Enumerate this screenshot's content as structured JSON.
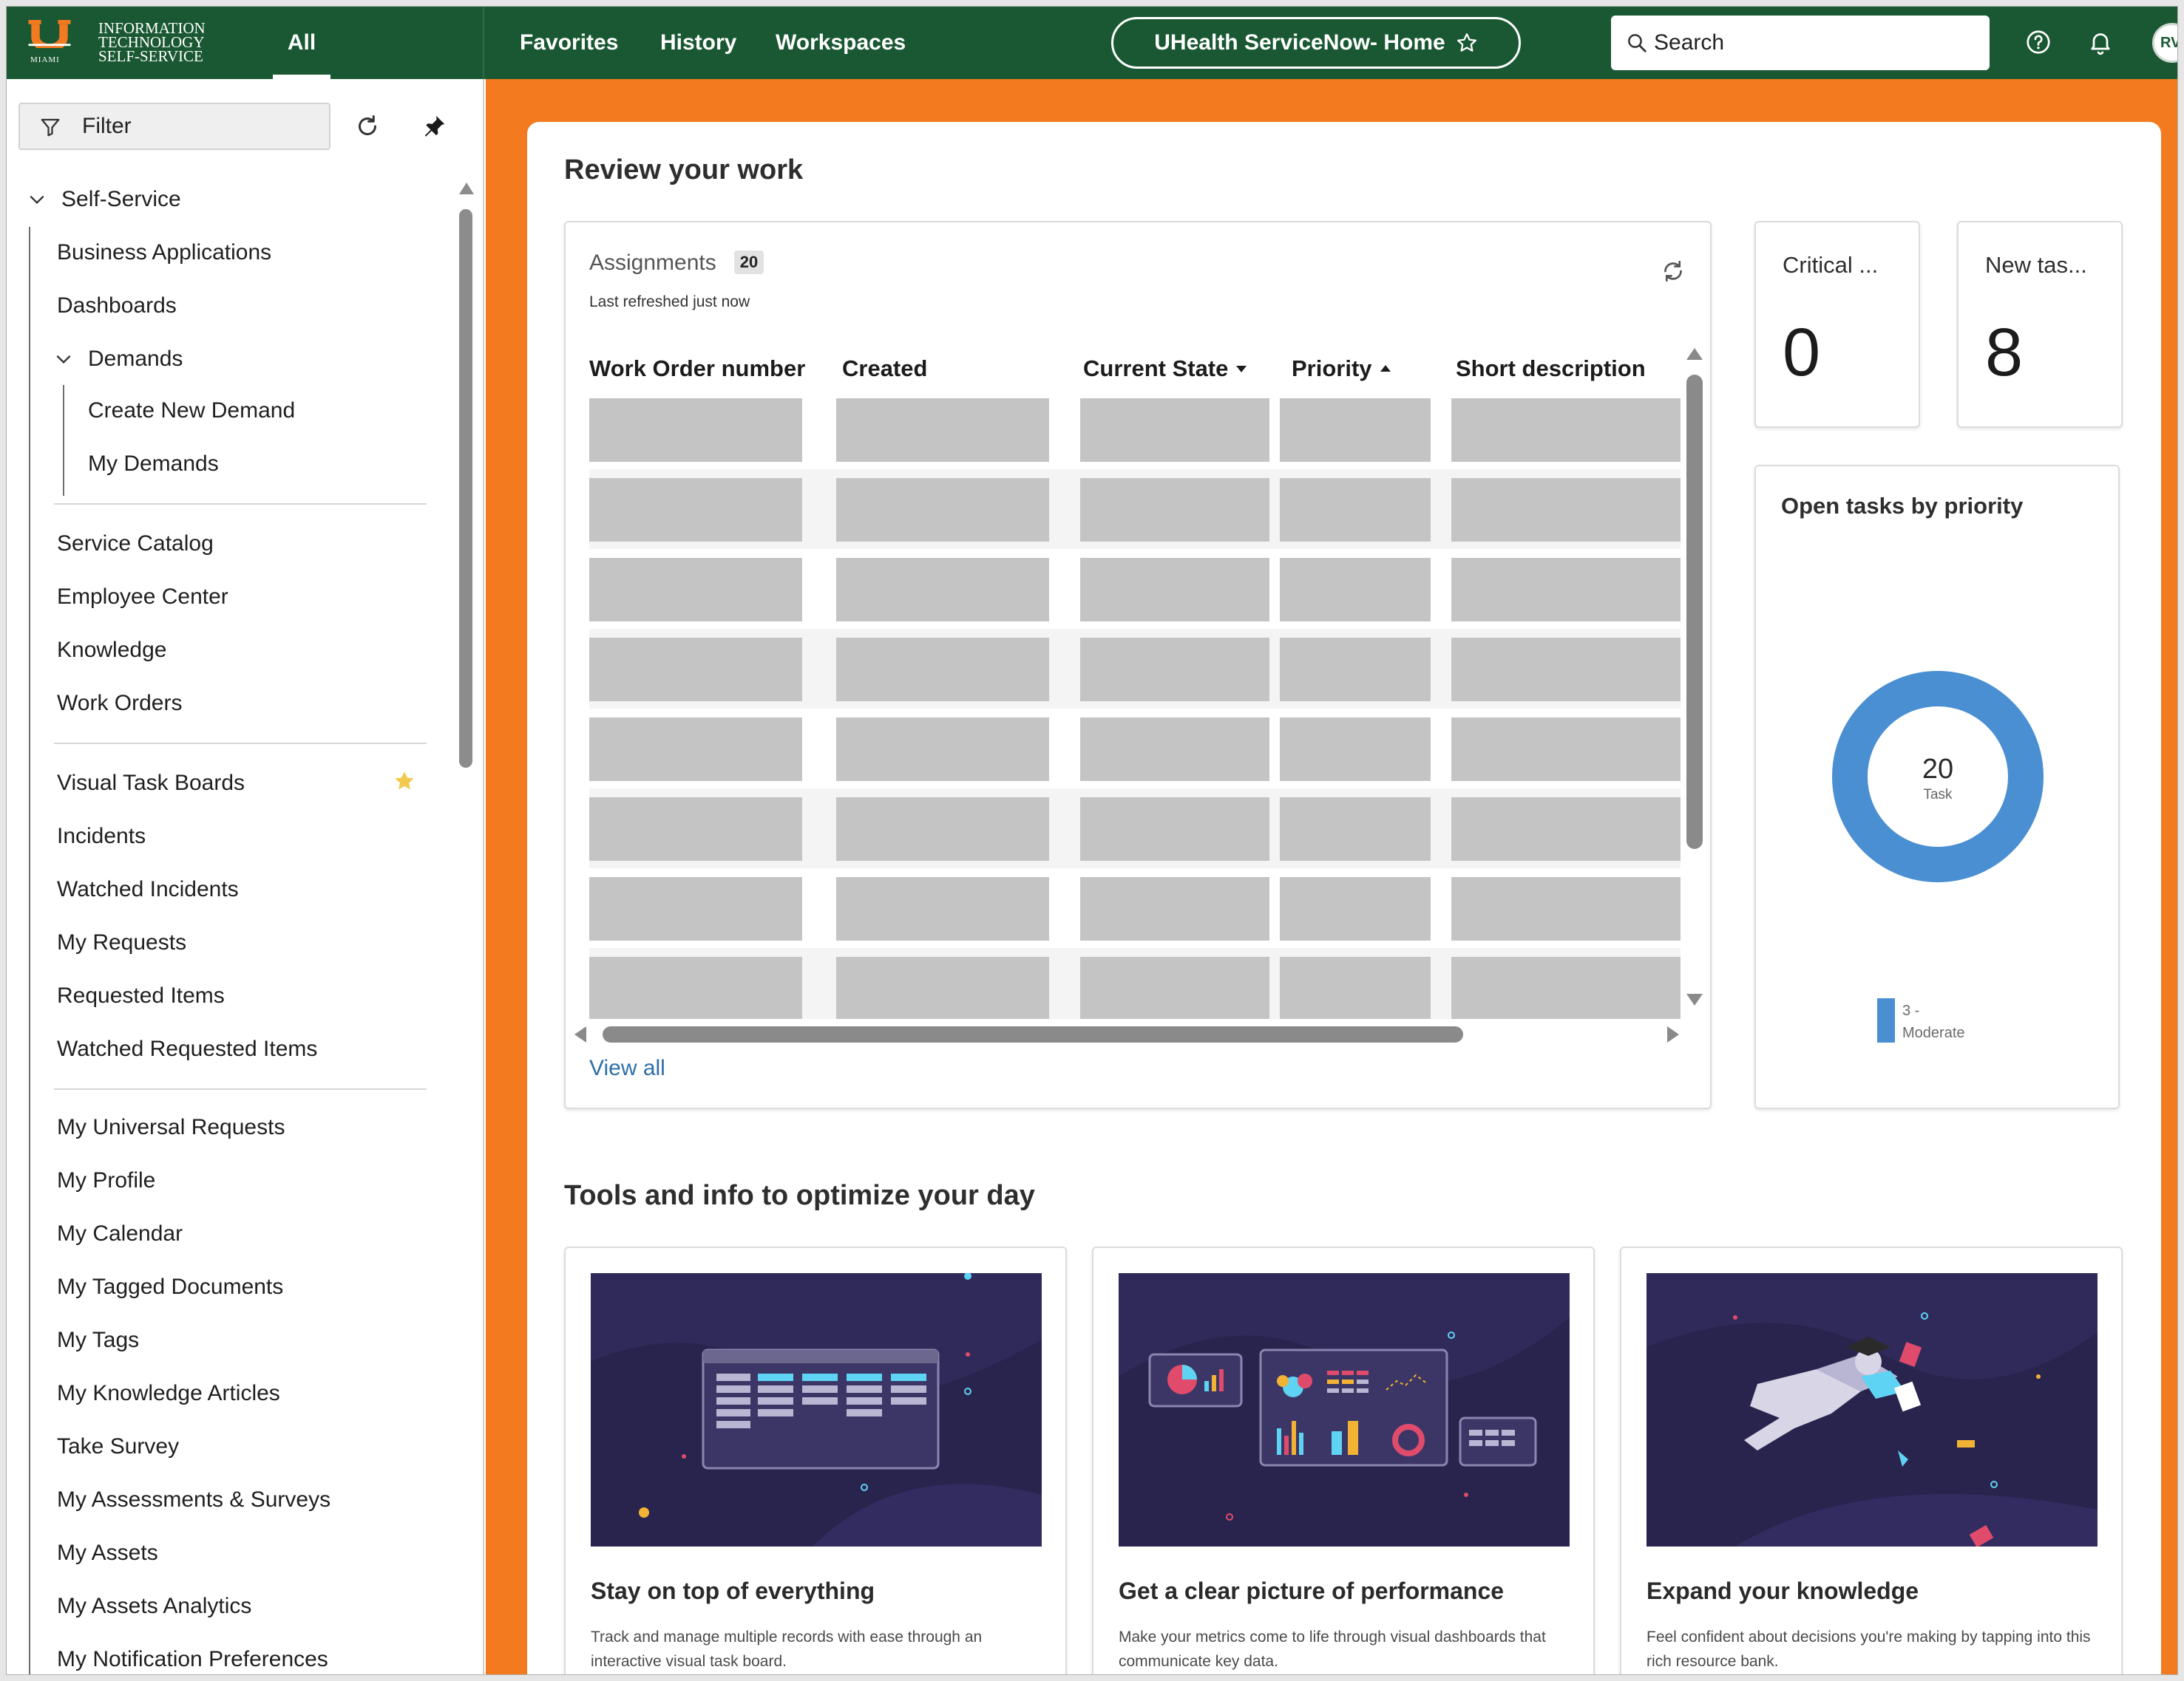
{
  "header": {
    "logo_text_line1": "INFORMATION",
    "logo_text_line2": "TECHNOLOGY",
    "logo_text_line3": "SELF-SERVICE",
    "logo_sub": "MIAMI",
    "all_tab": "All",
    "nav": [
      "Favorites",
      "History",
      "Workspaces"
    ],
    "home_pill": "UHealth ServiceNow- Home",
    "search_placeholder": "Search",
    "avatar_initials": "RV",
    "brand_green": "#195832"
  },
  "sidebar": {
    "filter_placeholder": "Filter",
    "group": "Self-Service",
    "items_top": [
      "Business Applications",
      "Dashboards"
    ],
    "demands": {
      "label": "Demands",
      "children": [
        "Create New Demand",
        "My Demands"
      ]
    },
    "items_mid": [
      "Service Catalog",
      "Employee Center",
      "Knowledge",
      "Work Orders"
    ],
    "items_tasks": [
      "Visual Task Boards",
      "Incidents",
      "Watched Incidents",
      "My Requests",
      "Requested Items",
      "Watched Requested Items"
    ],
    "items_bottom": [
      "My Universal Requests",
      "My Profile",
      "My Calendar",
      "My Tagged Documents",
      "My Tags",
      "My Knowledge Articles",
      "Take Survey",
      "My Assessments & Surveys",
      "My Assets",
      "My Assets Analytics",
      "My Notification Preferences"
    ],
    "favorite_item": "Visual Task Boards"
  },
  "main": {
    "accent_orange": "#f47a20",
    "review_title": "Review your work",
    "assignments": {
      "title": "Assignments",
      "count": "20",
      "refreshed": "Last refreshed just now",
      "columns": [
        "Work Order number",
        "Created",
        "Current State",
        "Priority",
        "Short description"
      ],
      "view_all": "View all"
    },
    "stats": [
      {
        "label": "Critical ...",
        "value": "0"
      },
      {
        "label": "New tas...",
        "value": "8"
      }
    ],
    "open_tasks": {
      "title": "Open tasks by priority",
      "total": "20",
      "unit": "Task",
      "legend_line1": "3 -",
      "legend_line2": "Moderate",
      "segment_color": "#4a8fd2"
    },
    "tools_title": "Tools and info to optimize your day",
    "tools": [
      {
        "title": "Stay on top of everything",
        "desc": "Track and manage multiple records with ease through an interactive visual task board."
      },
      {
        "title": "Get a clear picture of performance",
        "desc": "Make your metrics come to life through visual dashboards that communicate key data."
      },
      {
        "title": "Expand your knowledge",
        "desc": "Feel confident about decisions you're making by tapping into this rich resource bank."
      }
    ]
  }
}
